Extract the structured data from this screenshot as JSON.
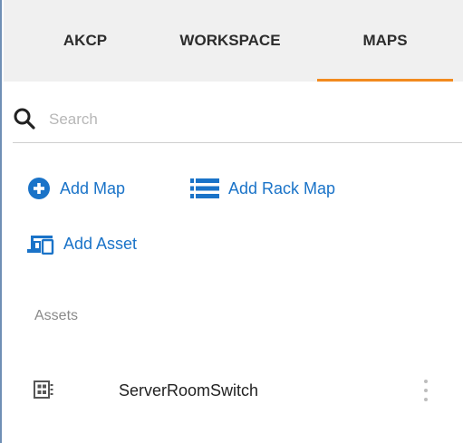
{
  "tabs": [
    {
      "label": "AKCP"
    },
    {
      "label": "WORKSPACE"
    },
    {
      "label": "MAPS",
      "active": true
    }
  ],
  "search": {
    "placeholder": "Search",
    "value": ""
  },
  "actions": {
    "add_map": "Add Map",
    "add_rack_map": "Add Rack Map",
    "add_asset": "Add Asset"
  },
  "assets": {
    "section_label": "Assets",
    "items": [
      {
        "name": "ServerRoomSwitch",
        "icon": "switch-device-icon"
      }
    ]
  },
  "colors": {
    "accent": "#f28a1e",
    "link": "#1a73c8",
    "tabbar_bg": "#f0f0f0"
  }
}
